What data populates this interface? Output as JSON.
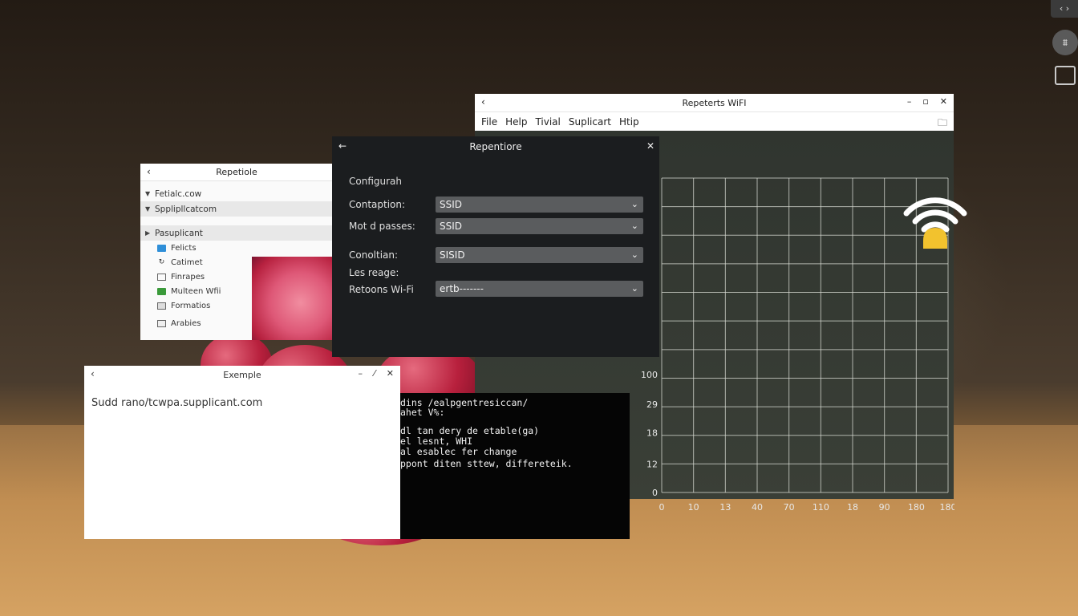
{
  "dock": {
    "top_label": "‹ ›",
    "circle_icon": "sliders-icon",
    "folder_icon": "folder-icon"
  },
  "wifi_window": {
    "title": "Repeterts WiFI",
    "menu": [
      "File",
      "Help",
      "Tivial",
      "Suplicart",
      "Htip"
    ],
    "grid": true
  },
  "chart_data": {
    "type": "line",
    "x_ticks": [
      "0",
      "10",
      "13",
      "40",
      "70",
      "110",
      "18",
      "90",
      "180",
      "180"
    ],
    "y_ticks": [
      "0",
      "12",
      "18",
      "29",
      "100"
    ],
    "series": [],
    "grid": true
  },
  "file_window": {
    "title": "Repetiole",
    "tree": [
      {
        "label": "Fetialc.cow",
        "selected": false
      },
      {
        "label": "Spplipllcatcom",
        "selected": true
      },
      {
        "label": "Pasuplicant",
        "selected": true
      }
    ],
    "items": [
      {
        "icon": "folder-icon",
        "label": "Felicts",
        "color": "#2f8fd8"
      },
      {
        "icon": "refresh-icon",
        "label": "Catimet",
        "color": "#555555"
      },
      {
        "icon": "file-icon",
        "label": "Finrapes",
        "color": "#555555"
      },
      {
        "icon": "folder-icon",
        "label": "Multeen Wfii",
        "color": "#3a9a3a"
      },
      {
        "icon": "document-icon",
        "label": "Formatios",
        "color": "#555555"
      },
      {
        "icon": "table-icon",
        "label": "Arabies",
        "color": "#555555"
      }
    ]
  },
  "dialog": {
    "title": "Repentiore",
    "heading": "Configurah",
    "rows": [
      {
        "label": "Contaption:",
        "value": "SSID"
      },
      {
        "label": "Mot d passes:",
        "value": "SSID"
      },
      {
        "label": "Conoltian:",
        "value": "SISID"
      },
      {
        "label": "Retoons Wi-Fi",
        "value": "ertb-------"
      }
    ],
    "extra_label": "Les reage:"
  },
  "example_window": {
    "title": "Exemple",
    "text": "Sudd rano/tcwpa.supplicant.com"
  },
  "terminal": {
    "lines": [
      "dins /ealpgentresiccan/",
      "ahet V%:",
      "",
      "dl tan dery de etable(ga)",
      "el lesnt, WHI",
      "al esablec fer change",
      "ppont diten sttew, differeteik."
    ]
  }
}
